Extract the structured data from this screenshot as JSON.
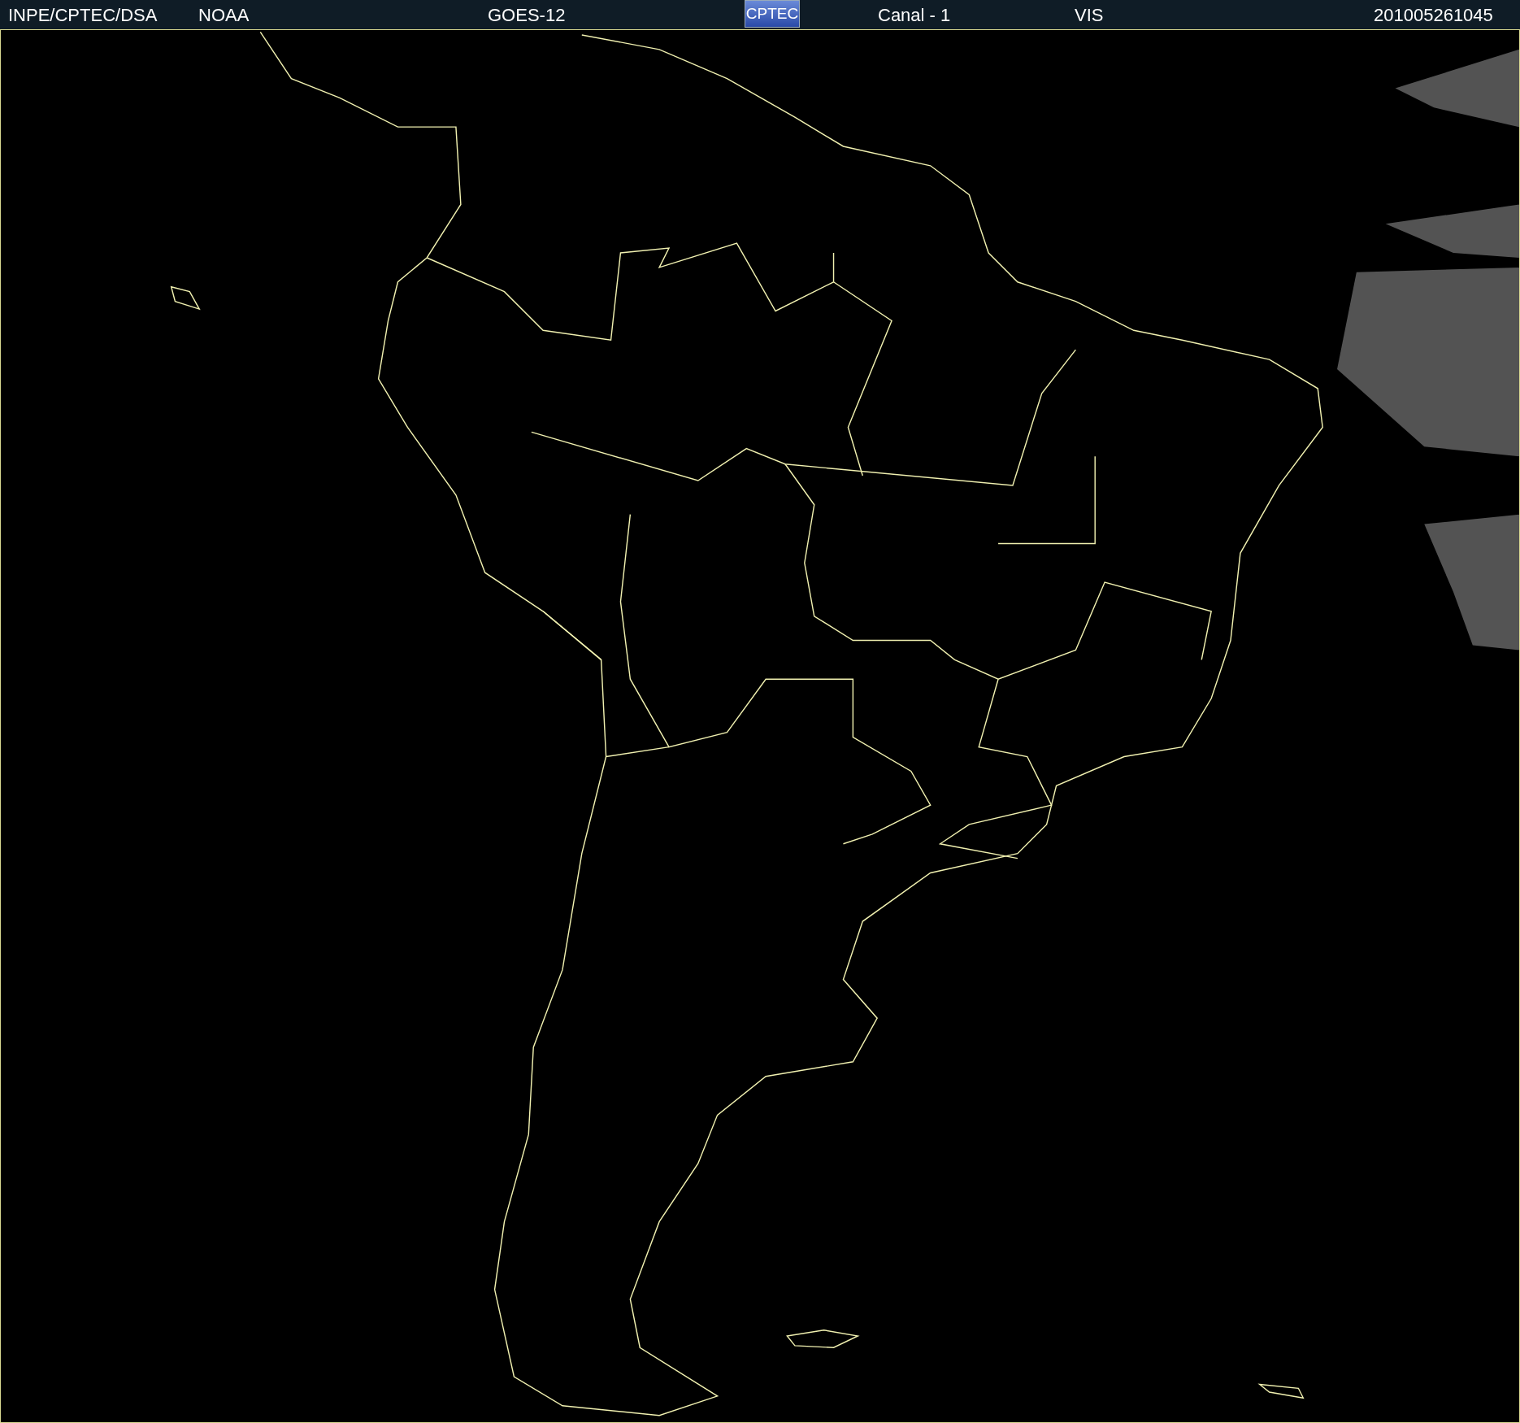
{
  "header": {
    "source": "INPE/CPTEC/DSA",
    "agency": "NOAA",
    "satellite": "GOES-12",
    "logo": "CPTEC",
    "channel": "Canal - 1",
    "band": "VIS",
    "timestamp": "201005261045"
  }
}
